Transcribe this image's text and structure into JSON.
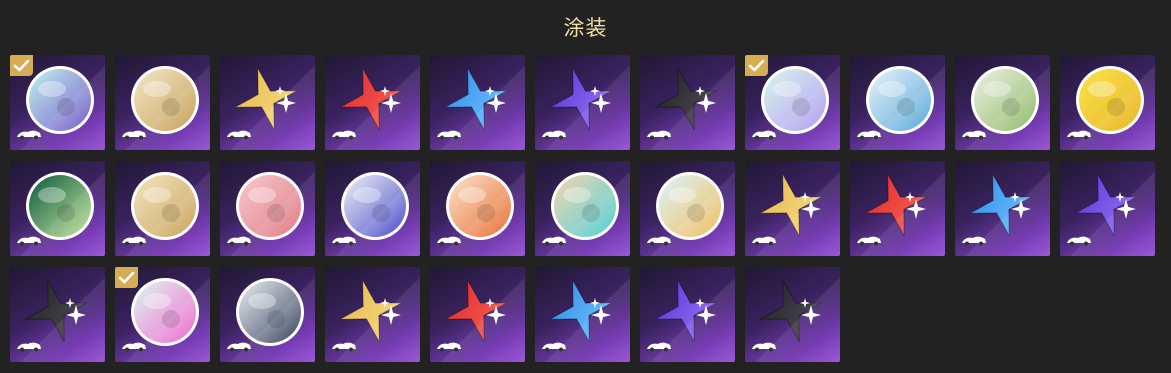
{
  "header": {
    "title": "涂装"
  },
  "colors": {
    "title": "#f1dfa9",
    "check": "#d8ac52",
    "tile_top": "#201833",
    "tile_bottom": "#9a58d6"
  },
  "rows": [
    [
      {
        "kind": "circle",
        "icon": "aurora-swirl-avatar",
        "check": true,
        "c1": "#bff3f0",
        "c2": "#7a5cc8"
      },
      {
        "kind": "circle",
        "icon": "character-portrait-avatar",
        "check": false,
        "c1": "#f4e8c8",
        "c2": "#c7a05a"
      },
      {
        "kind": "star",
        "icon": "gold-star-emblem",
        "check": false,
        "c1": "#e8b84a",
        "c2": "#f6dd8a"
      },
      {
        "kind": "star",
        "icon": "red-star-emblem",
        "check": false,
        "c1": "#d8242b",
        "c2": "#ff6a5a"
      },
      {
        "kind": "star",
        "icon": "blue-star-emblem",
        "check": false,
        "c1": "#2a88e8",
        "c2": "#78c8ff"
      },
      {
        "kind": "star",
        "icon": "purple-star-emblem",
        "check": false,
        "c1": "#5b2fd0",
        "c2": "#9a7cff"
      },
      {
        "kind": "star",
        "icon": "black-star-emblem",
        "check": false,
        "c1": "#1b1b1f",
        "c2": "#55545c"
      },
      {
        "kind": "circle",
        "icon": "pastel-crystal-avatar",
        "check": true,
        "c1": "#d8f6ee",
        "c2": "#b39ef0"
      },
      {
        "kind": "circle",
        "icon": "wave-pattern-avatar",
        "check": false,
        "c1": "#e8f4fa",
        "c2": "#5aa7d8"
      },
      {
        "kind": "circle",
        "icon": "plush-characters-avatar",
        "check": false,
        "c1": "#eef0e4",
        "c2": "#8fbb6a"
      },
      {
        "kind": "circle",
        "icon": "yellow-robot-avatar",
        "check": false,
        "c1": "#f9e34a",
        "c2": "#e9b62a"
      }
    ],
    [
      {
        "kind": "circle",
        "icon": "green-crest-avatar",
        "check": false,
        "c1": "#0d5a3e",
        "c2": "#c7e7a0"
      },
      {
        "kind": "circle",
        "icon": "golden-sphere-avatar",
        "check": false,
        "c1": "#f2e5c2",
        "c2": "#caa55e"
      },
      {
        "kind": "circle",
        "icon": "pink-portrait-avatar",
        "check": false,
        "c1": "#f8c8cc",
        "c2": "#e07d88"
      },
      {
        "kind": "circle",
        "icon": "blue-crest-avatar",
        "check": false,
        "c1": "#eef0f8",
        "c2": "#4a4ec8"
      },
      {
        "kind": "circle",
        "icon": "cartoon-crowd-avatar",
        "check": false,
        "c1": "#fbe2c8",
        "c2": "#e8713a"
      },
      {
        "kind": "circle",
        "icon": "cyan-mask-avatar",
        "check": false,
        "c1": "#f7d5b0",
        "c2": "#4fd1d8"
      },
      {
        "kind": "circle",
        "icon": "chibi-hero-avatar",
        "check": false,
        "c1": "#dcf3fb",
        "c2": "#f0c060"
      },
      {
        "kind": "star",
        "icon": "gold-star-emblem",
        "check": false,
        "c1": "#e8b84a",
        "c2": "#f6dd8a"
      },
      {
        "kind": "star",
        "icon": "red-star-emblem",
        "check": false,
        "c1": "#d8242b",
        "c2": "#ff6a5a"
      },
      {
        "kind": "star",
        "icon": "blue-star-emblem",
        "check": false,
        "c1": "#2a88e8",
        "c2": "#78c8ff"
      },
      {
        "kind": "star",
        "icon": "purple-star-emblem",
        "check": false,
        "c1": "#5b2fd0",
        "c2": "#9a7cff"
      }
    ],
    [
      {
        "kind": "star",
        "icon": "black-star-emblem",
        "check": false,
        "c1": "#1b1b1f",
        "c2": "#55545c"
      },
      {
        "kind": "circle",
        "icon": "pink-cat-avatar",
        "check": true,
        "c1": "#dff7f2",
        "c2": "#f06ad0"
      },
      {
        "kind": "circle",
        "icon": "dark-hair-portrait-avatar",
        "check": false,
        "c1": "#e9edf2",
        "c2": "#3a4660"
      },
      {
        "kind": "star",
        "icon": "gold-star-emblem",
        "check": false,
        "c1": "#e8b84a",
        "c2": "#f6dd8a"
      },
      {
        "kind": "star",
        "icon": "red-star-emblem",
        "check": false,
        "c1": "#d8242b",
        "c2": "#ff6a5a"
      },
      {
        "kind": "star",
        "icon": "blue-star-emblem",
        "check": false,
        "c1": "#2a88e8",
        "c2": "#78c8ff"
      },
      {
        "kind": "star",
        "icon": "purple-star-emblem",
        "check": false,
        "c1": "#5b2fd0",
        "c2": "#9a7cff"
      },
      {
        "kind": "star",
        "icon": "black-star-emblem",
        "check": false,
        "c1": "#1b1b1f",
        "c2": "#55545c"
      }
    ]
  ]
}
